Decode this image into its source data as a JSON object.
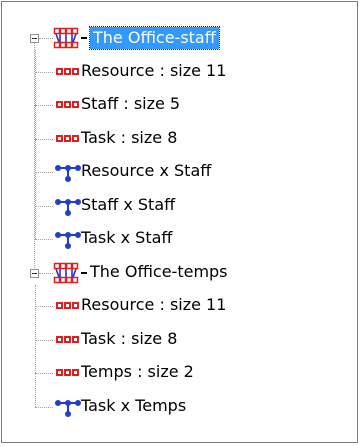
{
  "tree": {
    "groups": [
      {
        "label": "The Office-staff",
        "selected": true,
        "icon": "network-graph-icon",
        "children": [
          {
            "label": "Resource : size 11",
            "icon": "node-set-icon"
          },
          {
            "label": "Staff : size 5",
            "icon": "node-set-icon"
          },
          {
            "label": "Task : size 8",
            "icon": "node-set-icon"
          },
          {
            "label": "Resource x Staff",
            "icon": "relation-icon"
          },
          {
            "label": "Staff x Staff",
            "icon": "relation-icon"
          },
          {
            "label": "Task x Staff",
            "icon": "relation-icon"
          }
        ]
      },
      {
        "label": "The Office-temps",
        "selected": false,
        "icon": "network-graph-icon",
        "children": [
          {
            "label": "Resource : size 11",
            "icon": "node-set-icon"
          },
          {
            "label": "Task : size 8",
            "icon": "node-set-icon"
          },
          {
            "label": "Temps : size 2",
            "icon": "node-set-icon"
          },
          {
            "label": "Task x Temps",
            "icon": "relation-icon"
          }
        ]
      }
    ]
  }
}
